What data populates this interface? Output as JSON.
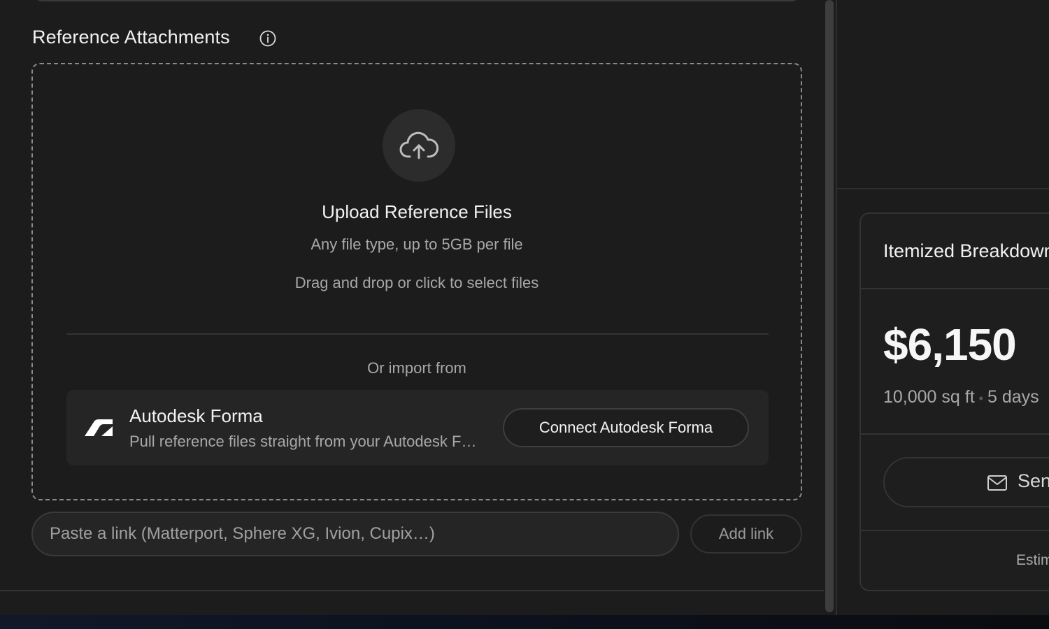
{
  "attachments": {
    "title": "Reference Attachments",
    "info_icon": "info-icon",
    "upload_icon": "cloud-upload-icon",
    "upload_title": "Upload Reference Files",
    "upload_subtitle": "Any file type, up to 5GB per file",
    "upload_hint": "Drag and drop or click to select files",
    "import_label": "Or import from",
    "integration": {
      "name": "Autodesk Forma",
      "description": "Pull reference files straight from your Autodesk Forma",
      "button_label": "Connect Autodesk Forma",
      "logo_icon": "autodesk-forma-logo"
    },
    "link_input": {
      "placeholder": "Paste a link (Matterport, Sphere XG, Ivion, Cupix…)",
      "value": ""
    },
    "add_link_label": "Add link"
  },
  "summary": {
    "title": "Itemized Breakdown",
    "price": "$6,150",
    "area": "10,000 sq ft",
    "duration": "5 days",
    "send_label": "Send",
    "send_icon": "mail-icon",
    "footer_label": "Estimate"
  }
}
